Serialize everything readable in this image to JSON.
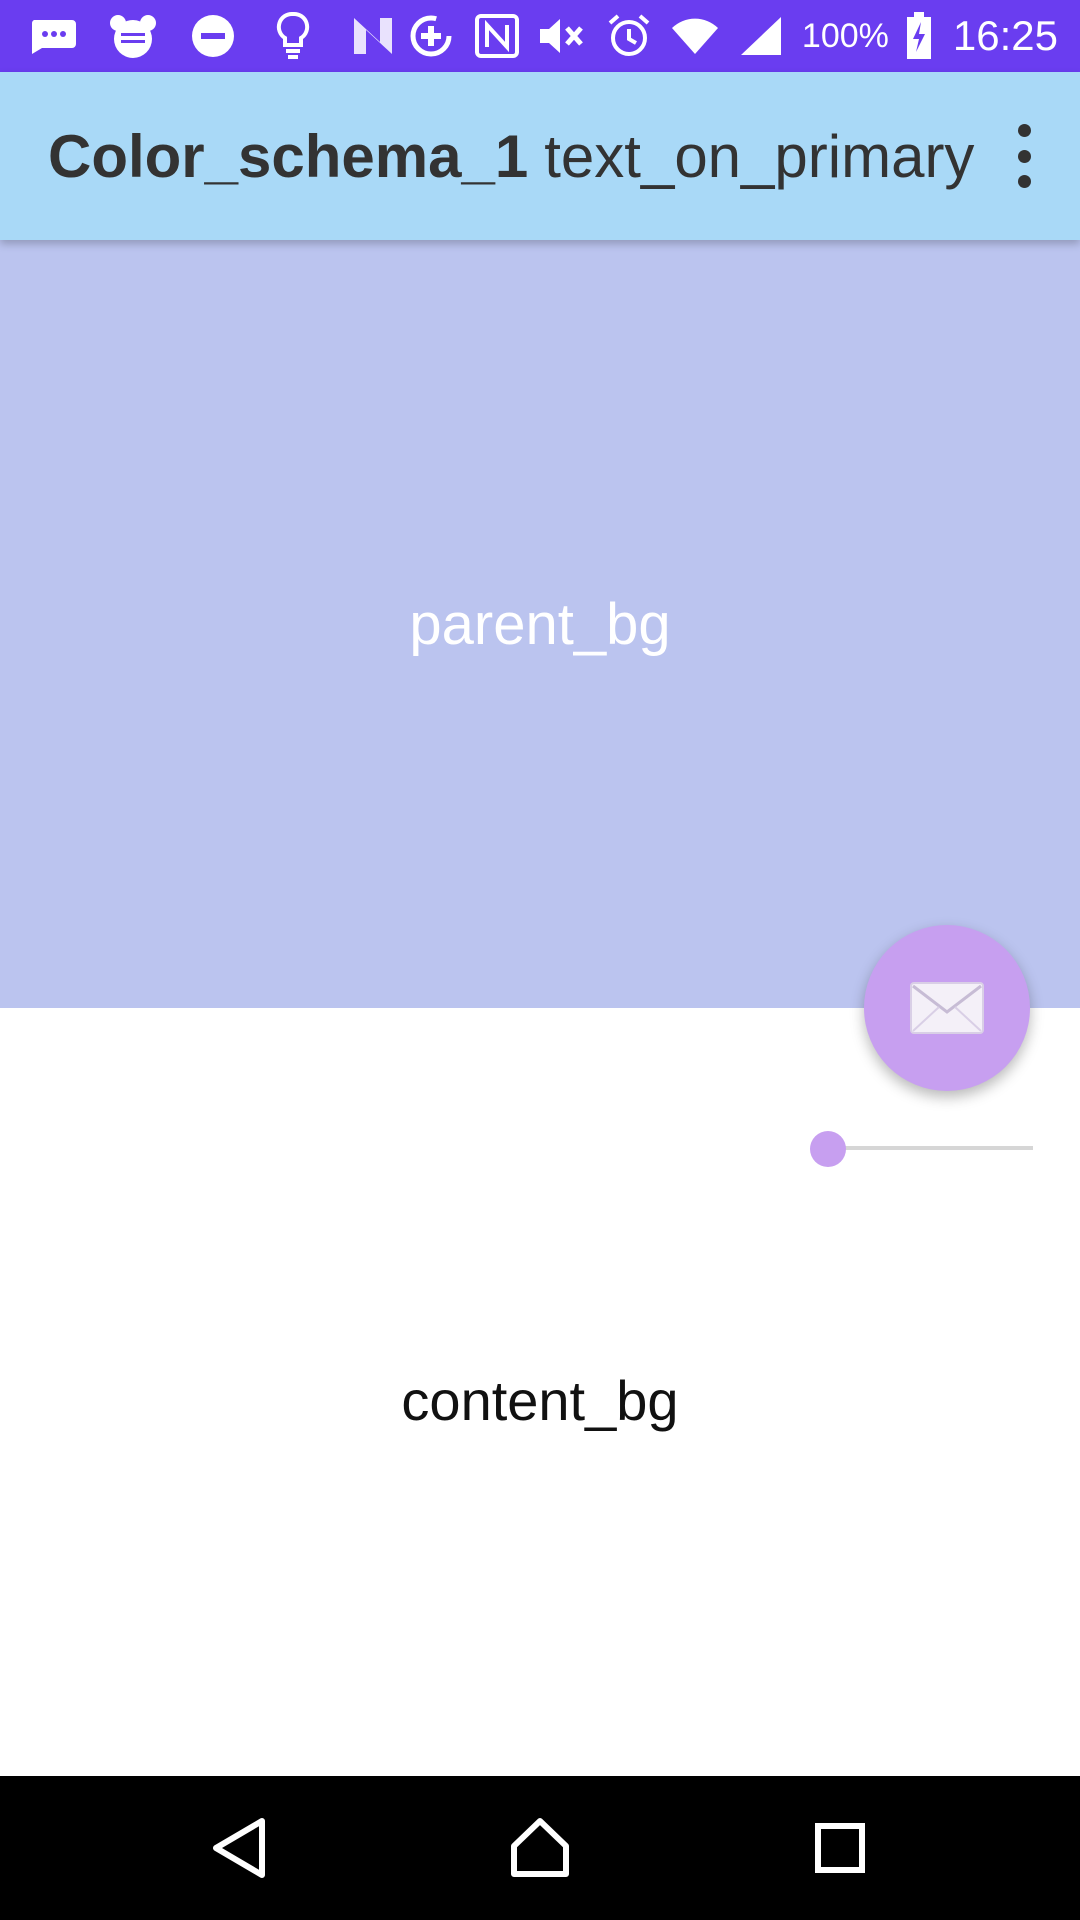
{
  "status_bar": {
    "battery": "100%",
    "time": "16:25",
    "left_icons": [
      "message-icon",
      "osaifu-keitai-icon",
      "do-not-disturb-icon",
      "lightbulb-icon",
      "n-icon"
    ],
    "right_icons": [
      "data-saver-icon",
      "nfc-icon",
      "mute-icon",
      "alarm-icon",
      "wifi-icon",
      "signal-icon",
      "battery-charging-icon"
    ],
    "background": "#6a3df0"
  },
  "app_bar": {
    "title_bold": "Color_schema_1",
    "title_rest": "text_on_primary",
    "background": "#a9d9f7",
    "menu_icon": "more-vert-icon"
  },
  "parent": {
    "label": "parent_bg",
    "background": "#bbc4ef"
  },
  "content": {
    "label": "content_bg",
    "background": "#ffffff"
  },
  "fab": {
    "icon": "mail-icon",
    "color": "#c79ff0"
  },
  "slider": {
    "value": 0,
    "accent": "#c79ff0"
  },
  "nav_bar": {
    "icons": [
      "back-icon",
      "home-icon",
      "recents-icon"
    ]
  }
}
